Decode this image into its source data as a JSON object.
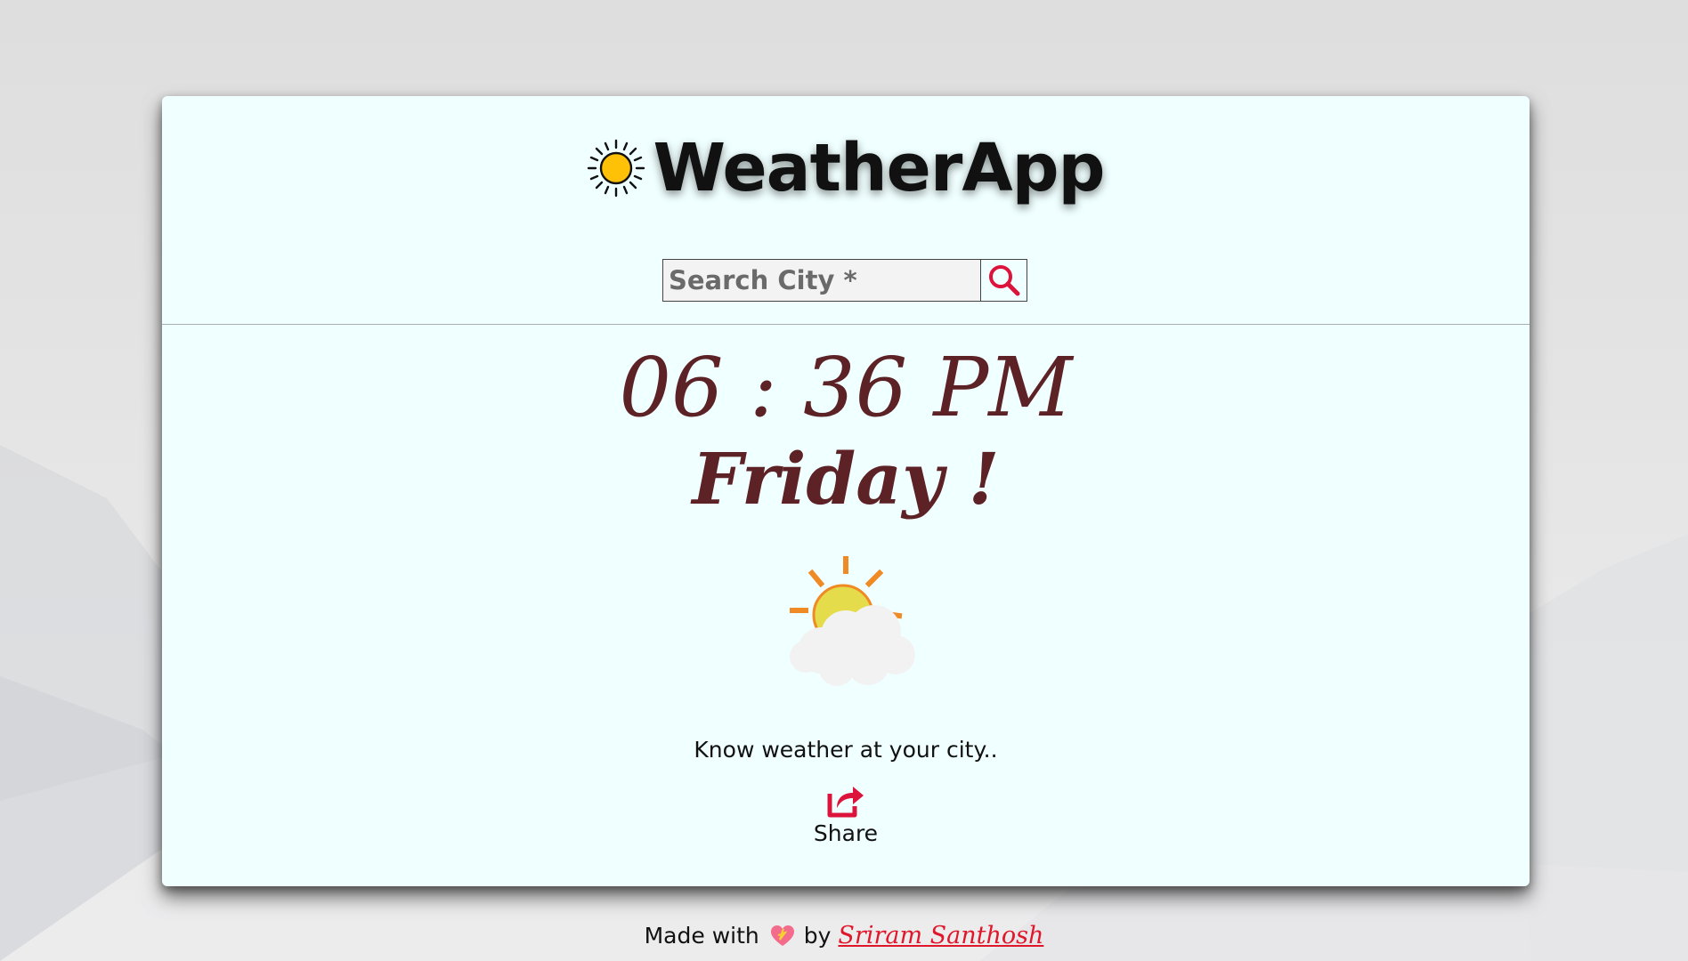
{
  "app": {
    "title": "WeatherApp",
    "brand_icon": "sun-icon"
  },
  "search": {
    "placeholder": "Search City *",
    "value": "",
    "button_icon": "search-icon"
  },
  "clock": {
    "time": "06 : 36 PM",
    "day": "Friday !"
  },
  "weather": {
    "illustration": "partly-cloudy-icon",
    "message": "Know weather at your city.."
  },
  "share": {
    "label": "Share",
    "icon": "share-icon"
  },
  "footer": {
    "made_with": "Made with",
    "heart_icon": "heart-icon",
    "by": "by",
    "author": "Sriram Santhosh"
  },
  "colors": {
    "card_background": "#f0ffff",
    "accent": "#dc143c",
    "clock_text": "#5c2226",
    "sun_yellow": "#ffc107",
    "ray_orange": "#f08a24"
  }
}
